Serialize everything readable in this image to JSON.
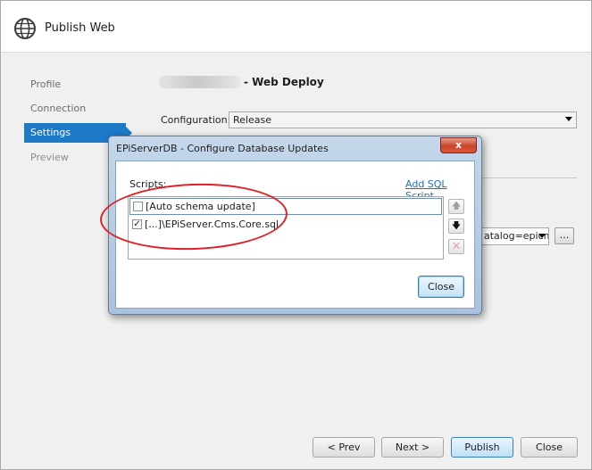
{
  "window": {
    "title": "Publish Web",
    "icon": "globe-icon"
  },
  "sidebar": {
    "items": [
      {
        "label": "Profile",
        "state": "normal"
      },
      {
        "label": "Connection",
        "state": "normal"
      },
      {
        "label": "Settings",
        "state": "active"
      },
      {
        "label": "Preview",
        "state": "disabled"
      }
    ]
  },
  "main": {
    "heading_suffix": "- Web Deploy",
    "configuration": {
      "label": "Configuration:",
      "value": "Release"
    },
    "connection_select_value": "atalog=epicms",
    "ellipsis_label": "..."
  },
  "footer": {
    "prev": "< Prev",
    "next": "Next >",
    "publish": "Publish",
    "close": "Close"
  },
  "dialog": {
    "title": "EPiServerDB - Configure Database Updates",
    "close_glyph": "x",
    "scripts_label": "Scripts:",
    "add_sql_link": "Add SQL Script",
    "scripts": [
      {
        "label": "[Auto schema update]",
        "checked": false
      },
      {
        "label": "[...]\\EPiServer.Cms.Core.sql",
        "checked": true
      }
    ],
    "move_up_glyph": "🡅",
    "move_down_glyph": "🡇",
    "delete_glyph": "✕",
    "close_button": "Close"
  },
  "colors": {
    "accent": "#1e7ac7",
    "annotation": "#e21f26",
    "link": "#1a6fc7"
  }
}
